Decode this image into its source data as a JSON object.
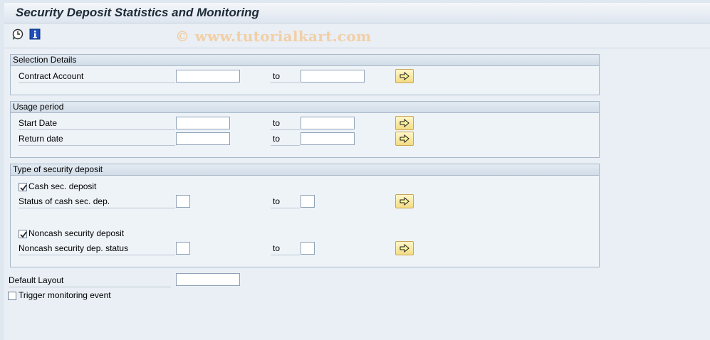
{
  "window": {
    "title": "Security Deposit Statistics and Monitoring"
  },
  "toolbar": {
    "execute_icon": "clock-execute-icon",
    "info_icon": "info-icon",
    "watermark": "© www.tutorialkart.com"
  },
  "selection_details": {
    "header": "Selection Details",
    "contract_account": {
      "label": "Contract Account",
      "from": "",
      "to_label": "to",
      "to": ""
    }
  },
  "usage_period": {
    "header": "Usage period",
    "start_date": {
      "label": "Start Date",
      "from": "",
      "to_label": "to",
      "to": ""
    },
    "return_date": {
      "label": "Return date",
      "from": "",
      "to_label": "to",
      "to": ""
    }
  },
  "deposit_type": {
    "header": "Type of security deposit",
    "cash": {
      "label": "Cash sec. deposit",
      "checked": true
    },
    "cash_status": {
      "label": "Status of cash sec. dep.",
      "from": "",
      "to_label": "to",
      "to": ""
    },
    "noncash": {
      "label": "Noncash security deposit",
      "checked": true
    },
    "noncash_status": {
      "label": "Noncash security dep. status",
      "from": "",
      "to_label": "to",
      "to": ""
    }
  },
  "default_layout": {
    "label": "Default Layout",
    "value": ""
  },
  "trigger_event": {
    "label": "Trigger monitoring event",
    "checked": false
  },
  "colors": {
    "title_bg": "#dde5ee",
    "content_bg": "#e9eff5",
    "button_yellow": "#f3dc83",
    "arrow": "#1a1a1a"
  }
}
